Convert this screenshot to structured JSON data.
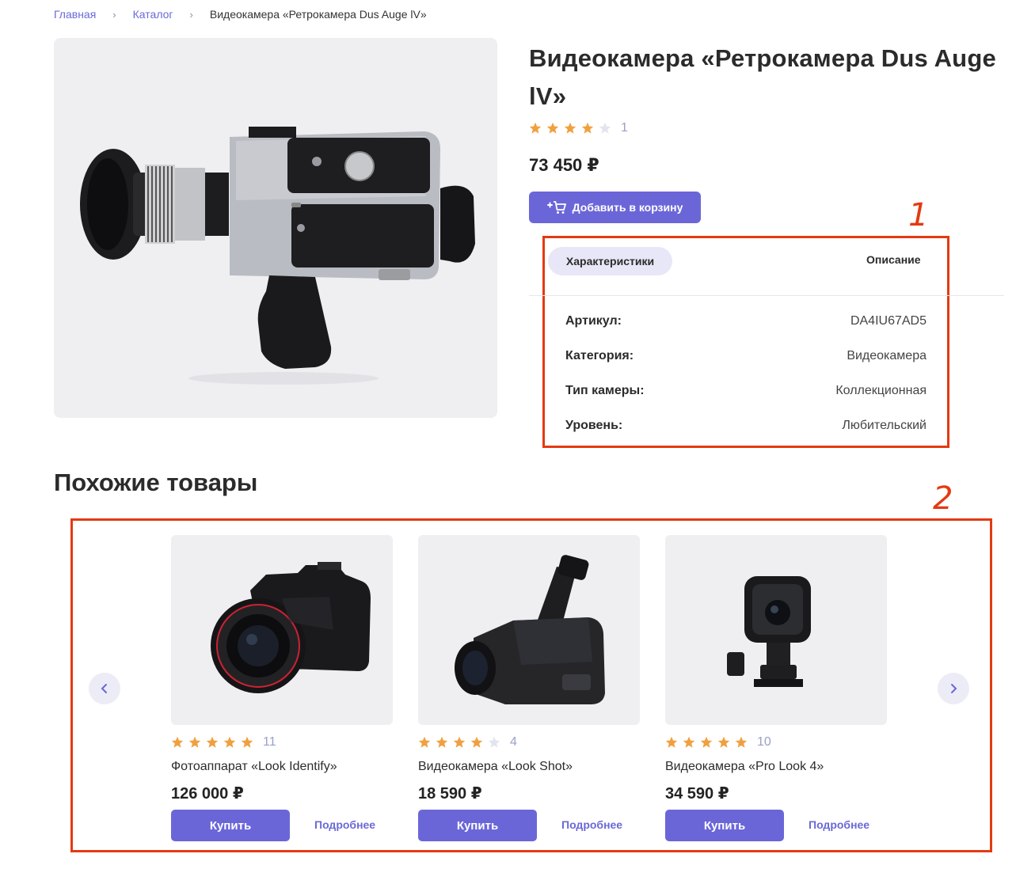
{
  "breadcrumb": {
    "home": "Главная",
    "catalog": "Каталог",
    "current": "Видеокамера «Ретрокамера Dus Auge lV»"
  },
  "product": {
    "title": "Видеокамера «Ретрокамера Dus Auge lV»",
    "rating": 4,
    "rating_max": 5,
    "reviews_count": "1",
    "price": "73 450 ₽",
    "add_to_cart_label": "Добавить в корзину",
    "image_icon": "retro-film-camera-photo"
  },
  "tabs": {
    "specs": "Характеристики",
    "description": "Описание",
    "active": "specs"
  },
  "specs": [
    {
      "key": "Артикул:",
      "value": "DA4IU67AD5"
    },
    {
      "key": "Категория:",
      "value": "Видеокамера"
    },
    {
      "key": "Тип камеры:",
      "value": "Коллекционная"
    },
    {
      "key": "Уровень:",
      "value": "Любительский"
    }
  ],
  "annotations": {
    "label_1": "1",
    "label_2": "2",
    "color": "#e33a12"
  },
  "similar": {
    "title": "Похожие товары",
    "prev_icon": "chevron-left-icon",
    "next_icon": "chevron-right-icon",
    "items": [
      {
        "name": "Фотоаппарат «Look Identify»",
        "rating": 5,
        "reviews_count": "11",
        "price": "126 000 ₽",
        "buy_label": "Купить",
        "more_label": "Подробнее",
        "image_icon": "dslr-camera-photo"
      },
      {
        "name": "Видеокамера «Look Shot»",
        "rating": 4,
        "reviews_count": "4",
        "price": "18 590 ₽",
        "buy_label": "Купить",
        "more_label": "Подробнее",
        "image_icon": "camcorder-photo"
      },
      {
        "name": "Видеокамера «Pro Look 4»",
        "rating": 5,
        "reviews_count": "10",
        "price": "34 590 ₽",
        "buy_label": "Купить",
        "more_label": "Подробнее",
        "image_icon": "action-camera-photo"
      }
    ]
  },
  "colors": {
    "accent": "#6b66d8",
    "star_filled": "#f0a040",
    "star_empty": "#e4e4ef"
  }
}
